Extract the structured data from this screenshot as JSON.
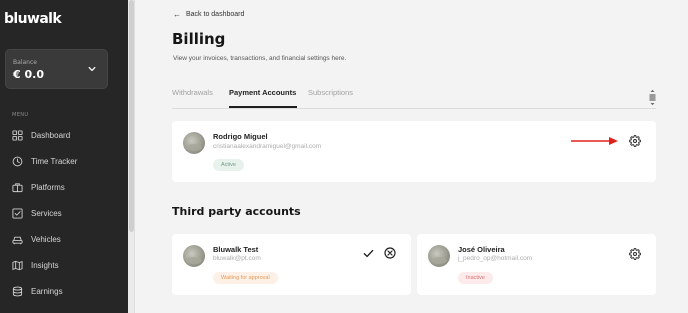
{
  "sidebar": {
    "logo": "bluwalk",
    "balance": {
      "label": "Balance",
      "value": "€ 0.0"
    },
    "menu_label": "MENU",
    "items": [
      {
        "label": "Dashboard",
        "icon": "grid-icon"
      },
      {
        "label": "Time Tracker",
        "icon": "clock-icon"
      },
      {
        "label": "Platforms",
        "icon": "briefcase-icon"
      },
      {
        "label": "Services",
        "icon": "checkbox-icon"
      },
      {
        "label": "Vehicles",
        "icon": "car-icon"
      },
      {
        "label": "Insights",
        "icon": "map-icon"
      },
      {
        "label": "Earnings",
        "icon": "database-icon"
      }
    ]
  },
  "main": {
    "back_link": "Back to dashboard",
    "title": "Billing",
    "subtitle": "View your invoices, transactions, and financial settings here.",
    "tabs": [
      {
        "label": "Withdrawals",
        "active": false
      },
      {
        "label": "Payment Accounts",
        "active": true
      },
      {
        "label": "Subscriptions",
        "active": false
      }
    ],
    "primary_account": {
      "name": "Rodrigo Miguel",
      "email": "cristianaalexandramiguel@gmail.com",
      "status": "Active"
    },
    "third_party_title": "Third party accounts",
    "third_party_accounts": [
      {
        "name": "Bluwalk Test",
        "email": "bluwalk@pt.com",
        "status": "Waiting for approval"
      },
      {
        "name": "José Oliveira",
        "email": "j_pedro_op@hotmail.com",
        "status": "Inactive"
      }
    ]
  },
  "colors": {
    "sidebar_bg": "#262626",
    "page_bg": "#f3f3f3",
    "annotation_arrow": "#e0211b",
    "badge_active": "#6c9d7e",
    "badge_waiting": "#e49a5b",
    "badge_inactive": "#d96f6f"
  }
}
